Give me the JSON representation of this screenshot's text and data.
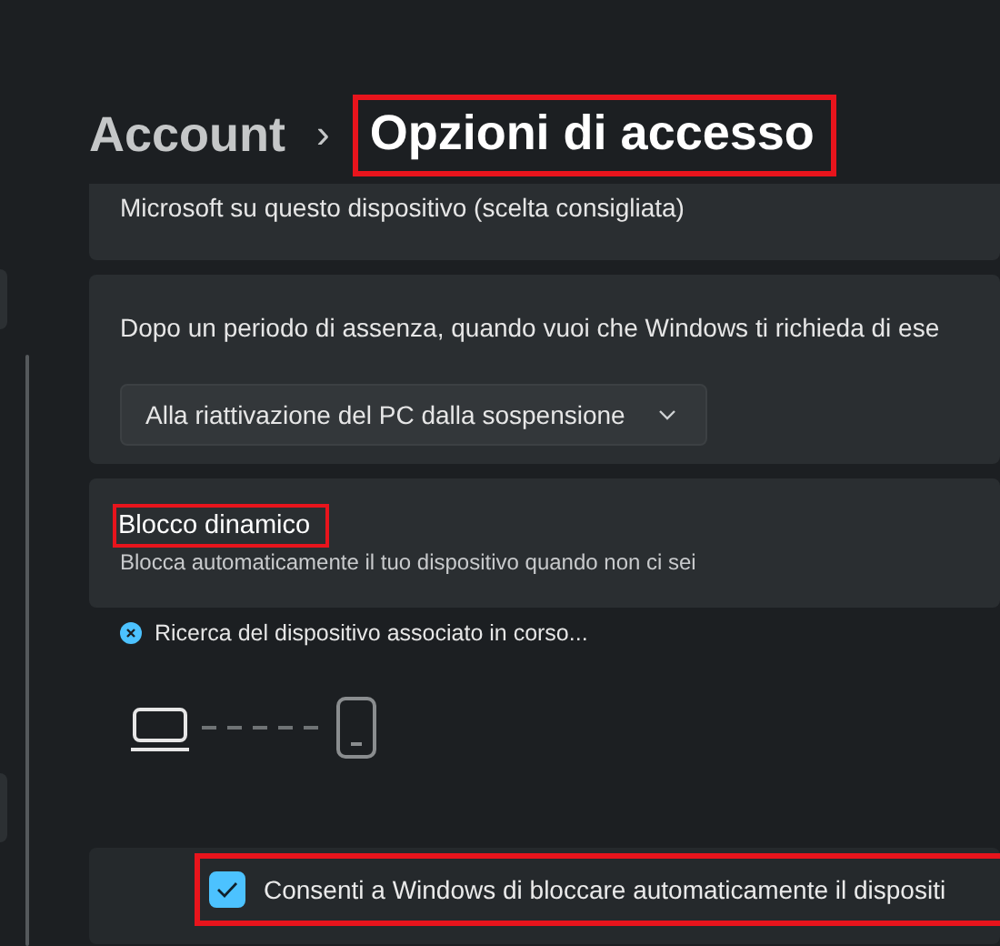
{
  "breadcrumb": {
    "parent": "Account",
    "separator": "›",
    "current": {
      "text": "Opzioni di accesso",
      "highlighted": true
    }
  },
  "cards": [
    {
      "kind": "text",
      "text": "Microsoft su questo dispositivo (scelta consigliata)"
    },
    {
      "kind": "dropdown",
      "text": "Dopo un periodo di assenza, quando vuoi che Windows ti richieda di ese",
      "value": "Alla riattivazione del PC dalla sospensione"
    },
    {
      "kind": "header",
      "title": {
        "text": "Blocco dinamico",
        "highlighted": true
      },
      "subtitle": "Blocca automaticamente il tuo dispositivo quando non ci sei"
    }
  ],
  "dynamic_lock": {
    "status": "Ricerca del dispositivo associato in corso...",
    "checkbox": {
      "label": "Consenti a Windows di bloccare automaticamente il dispositi",
      "checked": true,
      "highlighted": true
    }
  }
}
